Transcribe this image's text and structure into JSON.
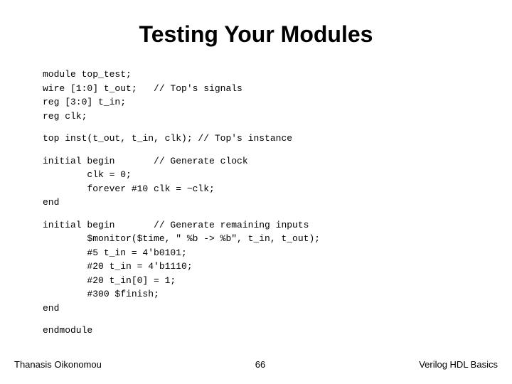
{
  "slide": {
    "title": "Testing Your Modules",
    "code_sections": [
      {
        "id": "module_def",
        "text": "module top_test;\nwire [1:0] t_out;   // Top's signals\nreg [3:0] t_in;\nreg clk;"
      },
      {
        "id": "instance_line",
        "text": "top inst(t_out, t_in, clk); // Top's instance"
      },
      {
        "id": "initial_clock",
        "text": "initial begin       // Generate clock\n        clk = 0;\n        forever #10 clk = ~clk;\nend"
      },
      {
        "id": "initial_inputs",
        "text": "initial begin       // Generate remaining inputs\n        $monitor($time, \" %b -> %b\", t_in, t_out);\n        #5 t_in = 4'b0101;\n        #20 t_in = 4'b1110;\n        #20 t_in[0] = 1;\n        #300 $finish;\nend"
      },
      {
        "id": "endmodule",
        "text": "endmodule"
      }
    ],
    "footer": {
      "left": "Thanasis Oikonomou",
      "center": "66",
      "right": "Verilog HDL Basics"
    }
  }
}
